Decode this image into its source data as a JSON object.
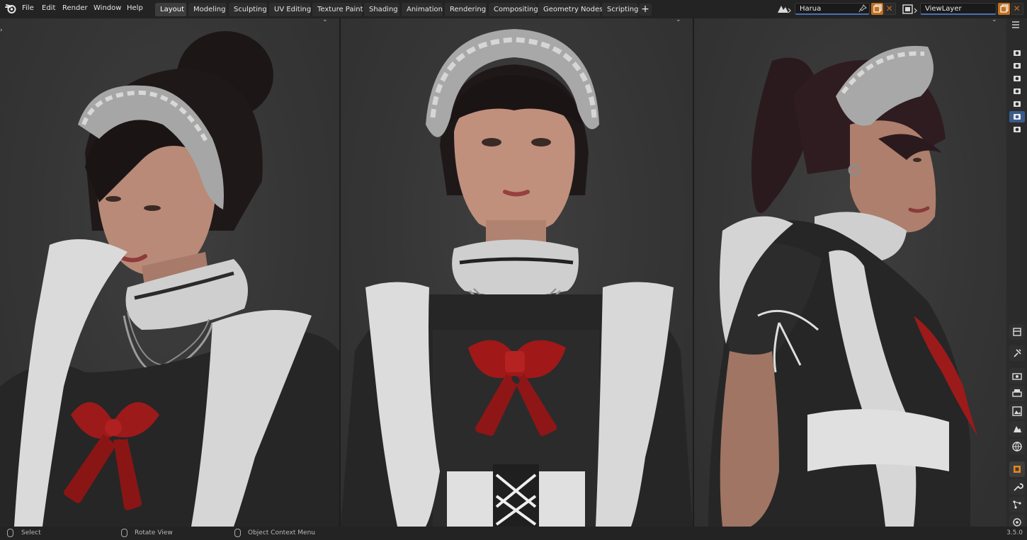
{
  "menu": [
    "File",
    "Edit",
    "Render",
    "Window",
    "Help"
  ],
  "workspaces": [
    "Layout",
    "Modeling",
    "Sculpting",
    "UV Editing",
    "Texture Paint",
    "Shading",
    "Animation",
    "Rendering",
    "Compositing",
    "Geometry Nodes",
    "Scripting"
  ],
  "active_workspace": "Layout",
  "scene": {
    "name": "Harua"
  },
  "view_layer": {
    "name": "ViewLayer"
  },
  "status": {
    "select": "Select",
    "rotate": "Rotate View",
    "context": "Object Context Menu",
    "version": "3.5.0"
  },
  "icons": {
    "logo": "blender-logo-icon",
    "scene": "scene-icon",
    "view_layer": "view-layer-icon",
    "pin": "pin-icon",
    "new": "new-copy-icon",
    "delete": "close-icon",
    "camera": "camera-icon"
  },
  "colors": {
    "accent_blue": "#4772b3",
    "accent_orange": "#c07020",
    "ribbon_red": "#a01818"
  }
}
